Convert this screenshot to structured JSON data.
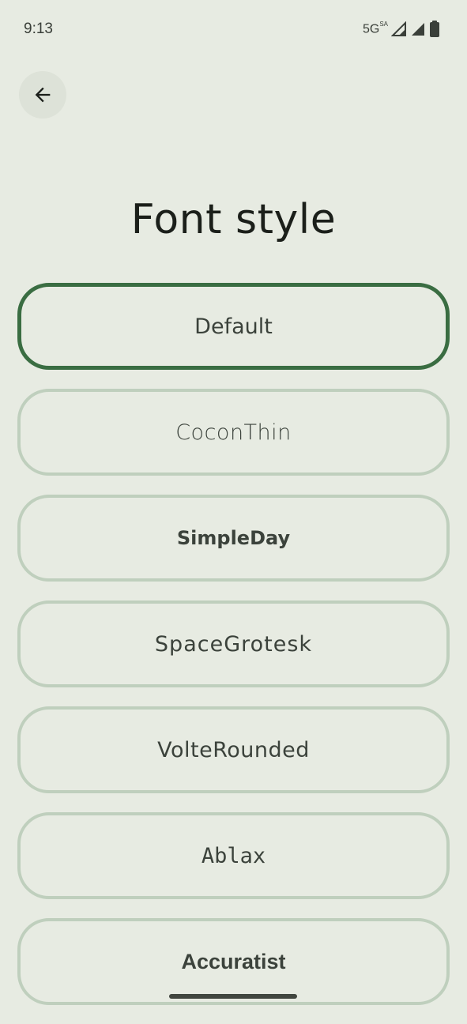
{
  "status_bar": {
    "time": "9:13",
    "network": "5G",
    "network_sup": "SA",
    "icons": [
      "signal-icon",
      "signal-icon",
      "battery-icon"
    ]
  },
  "header": {
    "back_icon": "arrow-back-icon",
    "title": "Font style"
  },
  "fonts": {
    "items": [
      {
        "label": "Default",
        "selected": true
      },
      {
        "label": "CoconThin",
        "selected": false
      },
      {
        "label": "SimpleDay",
        "selected": false
      },
      {
        "label": "SpaceGrotesk",
        "selected": false
      },
      {
        "label": "VolteRounded",
        "selected": false
      },
      {
        "label": "Ablax",
        "selected": false
      },
      {
        "label": "Accuratist",
        "selected": false
      }
    ]
  },
  "colors": {
    "background": "#e7ebe2",
    "selected_border": "#3a6d42",
    "unselected_border": "#bfcfbd"
  }
}
